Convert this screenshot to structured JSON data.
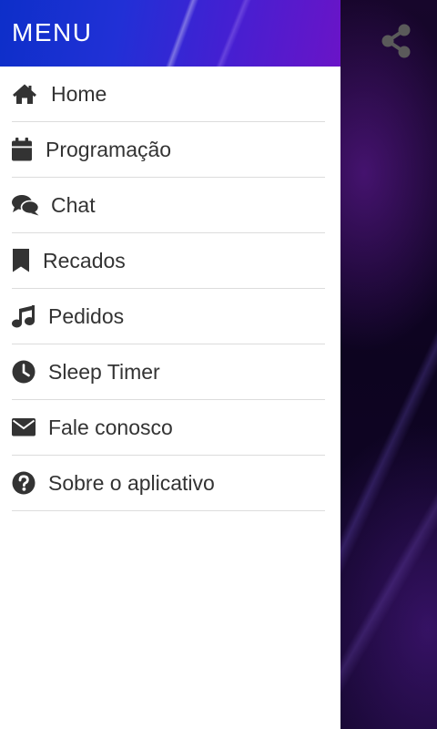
{
  "menu": {
    "title": "MENU",
    "items": [
      {
        "label": "Home",
        "icon": "home-icon"
      },
      {
        "label": "Programação",
        "icon": "calendar-icon"
      },
      {
        "label": "Chat",
        "icon": "chat-icon"
      },
      {
        "label": "Recados",
        "icon": "bookmark-icon"
      },
      {
        "label": "Pedidos",
        "icon": "music-note-icon"
      },
      {
        "label": "Sleep Timer",
        "icon": "clock-icon"
      },
      {
        "label": "Fale conosco",
        "icon": "envelope-icon"
      },
      {
        "label": "Sobre o aplicativo",
        "icon": "help-circle-icon"
      }
    ]
  },
  "toolbar": {
    "share_icon": "share-icon"
  },
  "colors": {
    "header_start": "#0d2fc9",
    "header_end": "#6a14c7",
    "icon": "#333333",
    "text": "#333333",
    "divider": "#dcdcdc",
    "background": "#12062a"
  }
}
